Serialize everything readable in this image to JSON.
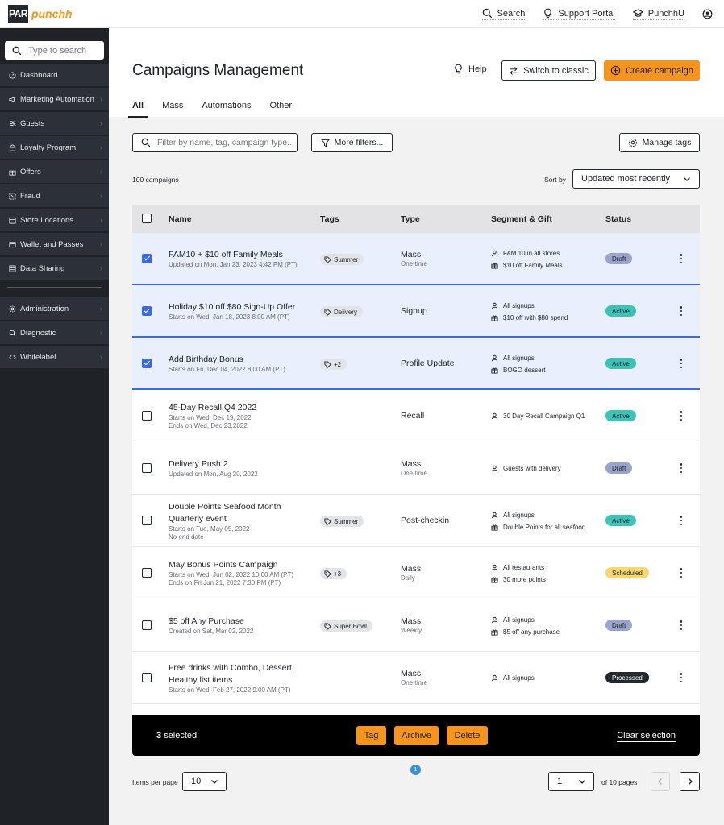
{
  "brand": {
    "logo_par": "PAR",
    "logo_punchh": "punchh",
    "accent": "#f7941d",
    "selection_blue": "#3a6ae3"
  },
  "topnav": [
    {
      "label": "Search",
      "icon": "search-icon"
    },
    {
      "label": "Support Portal",
      "icon": "lightbulb-icon"
    },
    {
      "label": "PunchhU",
      "icon": "graduation-cap-icon"
    }
  ],
  "sidebar": {
    "search_placeholder": "Type to search",
    "items": [
      {
        "label": "Dashboard",
        "icon": "dashboard-icon",
        "chevron": false
      },
      {
        "label": "Marketing Automation",
        "icon": "megaphone-icon",
        "chevron": true
      },
      {
        "label": "Guests",
        "icon": "users-icon",
        "chevron": true
      },
      {
        "label": "Loyalty Program",
        "icon": "lock-icon",
        "chevron": true
      },
      {
        "label": "Offers",
        "icon": "gift-icon",
        "chevron": true
      },
      {
        "label": "Fraud",
        "icon": "fraud-icon",
        "chevron": true
      },
      {
        "label": "Store Locations",
        "icon": "store-icon",
        "chevron": true
      },
      {
        "label": "Wallet and Passes",
        "icon": "wallet-icon",
        "chevron": true
      },
      {
        "label": "Data Sharing",
        "icon": "database-icon",
        "chevron": true
      }
    ],
    "items_bottom": [
      {
        "label": "Administration",
        "icon": "gear-icon",
        "chevron": true
      },
      {
        "label": "Diagnostic",
        "icon": "diagnostic-icon",
        "chevron": true
      },
      {
        "label": "Whitelabel",
        "icon": "code-icon",
        "chevron": true
      }
    ]
  },
  "header": {
    "title": "Campaigns Management",
    "help_label": "Help",
    "switch_label": "Switch to classic",
    "create_label": "Create campaign",
    "tabs": [
      "All",
      "Mass",
      "Automations",
      "Other"
    ],
    "active_tab": "All"
  },
  "filters": {
    "search_placeholder": "Filter by name, tag, campaign type...",
    "more_filters_label": "More filters...",
    "manage_tags_label": "Manage tags",
    "count_label": "100 campaigns",
    "sort_label": "Sort by",
    "sort_value": "Updated most recently"
  },
  "table": {
    "columns": [
      "Name",
      "Tags",
      "Type",
      "Segment & Gift",
      "Status"
    ],
    "rows": [
      {
        "selected": true,
        "name": "FAM10 + $10 off Family Meals",
        "sub": [
          "Updated on Mon, Jan 23, 2023 4:42 PM (PT)"
        ],
        "tag": "Summer",
        "type": "Mass",
        "type_sub": "One-time",
        "segment": "FAM 10 in all stores",
        "gift": "$10 off Family Meals",
        "status": "Draft"
      },
      {
        "selected": true,
        "name": "Holiday $10 off $80 Sign-Up Offer",
        "sub": [
          "Starts on Wed, Jan 18, 2023 8:00 AM (PT)"
        ],
        "tag": "Delivery",
        "type": "Signup",
        "type_sub": "",
        "segment": "All signups",
        "gift": "$10 off with $80 spend",
        "status": "Active"
      },
      {
        "selected": true,
        "name": "Add Birthday Bonus",
        "sub": [
          "Starts on Fri, Dec 04, 2022 8:00 AM (PT)"
        ],
        "tag": "+2",
        "type": "Profile Update",
        "type_sub": "",
        "segment": "All signups",
        "gift": "BOGO dessert",
        "status": "Active"
      },
      {
        "selected": false,
        "name": "45-Day Recall Q4 2022",
        "sub": [
          "Starts on Wed, Dec 19, 2022",
          "Ends on Wed, Dec 23,2022"
        ],
        "tag": "",
        "type": "Recall",
        "type_sub": "",
        "segment": "30 Day Recall Campaign Q1",
        "gift": "",
        "status": "Active"
      },
      {
        "selected": false,
        "name": "Delivery Push 2",
        "sub": [
          "Updated on Mon, Aug 20, 2022"
        ],
        "tag": "",
        "type": "Mass",
        "type_sub": "One-time",
        "segment": "Guests with delivery",
        "gift": "",
        "status": "Draft"
      },
      {
        "selected": false,
        "name": "Double Points Seafood Month Quarterly event",
        "sub": [
          "Starts on Tue, May 05, 2022",
          "No end date"
        ],
        "tag": "Summer",
        "type": "Post-checkin",
        "type_sub": "",
        "segment": "All signups",
        "gift": "Double Points for all seafood",
        "status": "Active"
      },
      {
        "selected": false,
        "name": "May Bonus Points Campaign",
        "sub": [
          "Starts on Wed, Jun 02, 2022 10:00 AM (PT)",
          "Ends on Fri Jun 21, 2022 7:30 PM (PT)"
        ],
        "tag": "+3",
        "type": "Mass",
        "type_sub": "Daily",
        "segment": "All restaurants",
        "gift": "30 more points",
        "status": "Scheduled"
      },
      {
        "selected": false,
        "name": "$5 off Any Purchase",
        "sub": [
          "Created on Sat, Mar 02, 2022"
        ],
        "tag": "Super Bowl",
        "type": "Mass",
        "type_sub": "Weekly",
        "segment": "All signups",
        "gift": "$5 off any purchase",
        "status": "Draft"
      },
      {
        "selected": false,
        "name": "Free drinks with Combo, Dessert, Healthy list items",
        "sub": [
          "Starts on Wed, Feb 27, 2022 9:00 AM (PT)"
        ],
        "tag": "",
        "type": "Mass",
        "type_sub": "One-time",
        "segment": "All signups",
        "gift": "",
        "status": "Processed"
      }
    ],
    "status_colors": {
      "Draft": "#9aa3c9",
      "Active": "#3cc3b8",
      "Scheduled": "#f7d774",
      "Processed": "#23272e"
    }
  },
  "selection_bar": {
    "count": "3",
    "label": "selected",
    "tag_label": "Tag",
    "archive_label": "Archive",
    "delete_label": "Delete",
    "clear_label": "Clear selection"
  },
  "pagination": {
    "page_dot": "1",
    "items_label": "Items per page",
    "items_value": "10",
    "page_value": "1",
    "of_pages": "of 10 pages"
  }
}
